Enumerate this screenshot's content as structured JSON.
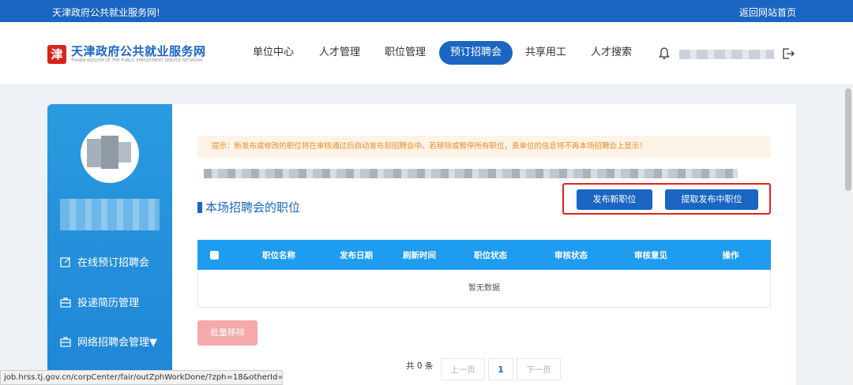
{
  "topbar": {
    "welcome": "天津政府公共就业服务网!",
    "back_link": "返回网站首页"
  },
  "logo": {
    "badge": "津",
    "title_cn": "天津政府公共就业服务网",
    "title_en": "TIANJIN WISDOM OF THE PUBLIC EMPLOYMENT SERVICE NETWORK"
  },
  "nav": {
    "items": [
      {
        "label": "单位中心"
      },
      {
        "label": "人才管理"
      },
      {
        "label": "职位管理"
      },
      {
        "label": "预订招聘会",
        "active": true
      },
      {
        "label": "共享用工"
      },
      {
        "label": "人才搜索"
      }
    ]
  },
  "sidebar": {
    "items": [
      {
        "label": "在线预订招聘会",
        "icon": "edit-icon"
      },
      {
        "label": "投递简历管理",
        "icon": "briefcase-icon"
      },
      {
        "label": "网络招聘会管理▼",
        "icon": "briefcase-icon"
      }
    ]
  },
  "main": {
    "notice": "提示：新发布或修改的职位将在审核通过后自动发布到招聘会中。若移除或暂停所有职位，贵单位的信息将不再本场招聘会上显示！",
    "section_title": "本场招聘会的职位",
    "publish_button": "发布新职位",
    "pick_button": "提取发布中职位",
    "table": {
      "headers": [
        "职位名称",
        "发布日期",
        "刷新时间",
        "职位状态",
        "审核状态",
        "审核意见",
        "操作"
      ],
      "empty_text": "暂无数据"
    },
    "batch_remove_button": "批量移除",
    "pagination": {
      "total": "共 0 条",
      "prev": "上一页",
      "current": "1",
      "next": "下一页"
    }
  },
  "statusbar": {
    "url": "job.hrss.tj.gov.cn/corpCenter/fair/outZphWorkDone/?zph=18&otherId=10..."
  },
  "colors": {
    "primary": "#1a66c2",
    "table_header": "#1e9cf0",
    "notice_text": "#f08a24",
    "highlight": "#e81f1f",
    "remove": "#f5a9a9"
  }
}
